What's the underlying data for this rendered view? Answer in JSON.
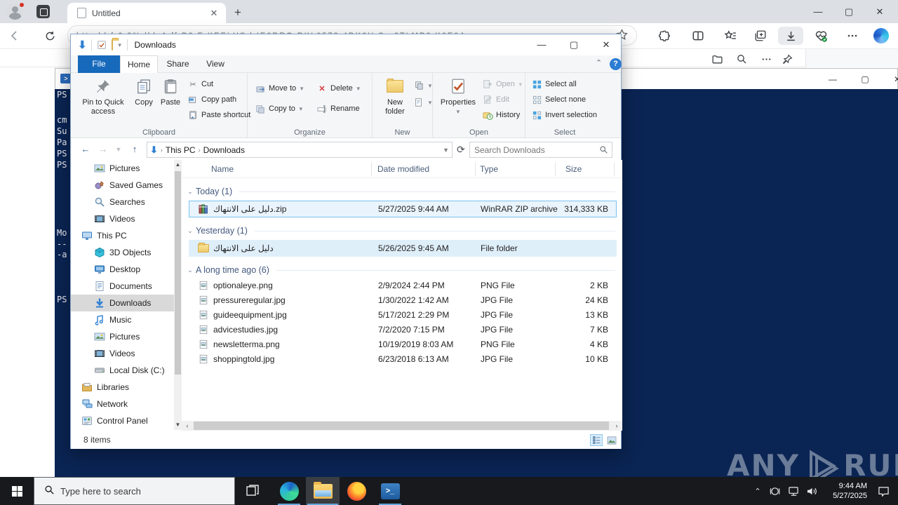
{
  "browser": {
    "tab_title": "Untitled",
    "url_fragment": "http  bl f   6.2%  lkk  A   ff.P6.E  KEELHS.l  IE6RRQ   RKL0573 4DK6U.Se  6TLMP6   K6E0A"
  },
  "powershell": {
    "console_lines": [
      "PS",
      "cm",
      "Su",
      "Pa",
      "PS",
      "PS",
      "Mo",
      "--",
      "-a",
      "PS"
    ]
  },
  "watermark": {
    "any": "ANY",
    "run": "RUN"
  },
  "explorer": {
    "title": "Downloads",
    "tabs": {
      "file": "File",
      "home": "Home",
      "share": "Share",
      "view": "View"
    },
    "ribbon": {
      "pin_to_quick_access": "Pin to Quick access",
      "copy": "Copy",
      "paste": "Paste",
      "cut": "Cut",
      "copy_path": "Copy path",
      "paste_shortcut": "Paste shortcut",
      "move_to": "Move to",
      "copy_to": "Copy to",
      "delete": "Delete",
      "rename": "Rename",
      "new_folder": "New folder",
      "properties": "Properties",
      "open": "Open",
      "edit": "Edit",
      "history": "History",
      "select_all": "Select all",
      "select_none": "Select none",
      "invert_selection": "Invert selection",
      "groups": {
        "clipboard": "Clipboard",
        "organize": "Organize",
        "new": "New",
        "open": "Open",
        "select": "Select"
      }
    },
    "address": {
      "breadcrumb": [
        "This PC",
        "Downloads"
      ],
      "search_placeholder": "Search Downloads"
    },
    "columns": [
      "Name",
      "Date modified",
      "Type",
      "Size"
    ],
    "file_groups": [
      {
        "label": "Today (1)",
        "rows": [
          {
            "name": "دليل على الانتهاك.zip",
            "date": "5/27/2025 9:44 AM",
            "type": "WinRAR ZIP archive",
            "size": "314,333 KB",
            "icon": "winrar",
            "state": "sel"
          }
        ]
      },
      {
        "label": "Yesterday (1)",
        "rows": [
          {
            "name": "دليل على الانتهاك",
            "date": "5/26/2025 9:45 AM",
            "type": "File folder",
            "size": "",
            "icon": "folder",
            "state": "hov"
          }
        ]
      },
      {
        "label": "A long time ago (6)",
        "rows": [
          {
            "name": "optionaleye.png",
            "date": "2/9/2024 2:44 PM",
            "type": "PNG File",
            "size": "2 KB",
            "icon": "image",
            "state": ""
          },
          {
            "name": "pressureregular.jpg",
            "date": "1/30/2022 1:42 AM",
            "type": "JPG File",
            "size": "24 KB",
            "icon": "image",
            "state": ""
          },
          {
            "name": "guideequipment.jpg",
            "date": "5/17/2021 2:29 PM",
            "type": "JPG File",
            "size": "13 KB",
            "icon": "image",
            "state": ""
          },
          {
            "name": "advicestudies.jpg",
            "date": "7/2/2020 7:15 PM",
            "type": "JPG File",
            "size": "7 KB",
            "icon": "image",
            "state": ""
          },
          {
            "name": "newsletterma.png",
            "date": "10/19/2019 8:03 AM",
            "type": "PNG File",
            "size": "4 KB",
            "icon": "image",
            "state": ""
          },
          {
            "name": "shoppingtold.jpg",
            "date": "6/23/2018 6:13 AM",
            "type": "JPG File",
            "size": "10 KB",
            "icon": "image",
            "state": ""
          }
        ]
      }
    ],
    "nav_items": [
      {
        "label": "Pictures",
        "icon": "pictures",
        "indent": 2
      },
      {
        "label": "Saved Games",
        "icon": "saved-games",
        "indent": 2
      },
      {
        "label": "Searches",
        "icon": "searches",
        "indent": 2
      },
      {
        "label": "Videos",
        "icon": "videos",
        "indent": 2
      },
      {
        "label": "This PC",
        "icon": "this-pc",
        "indent": 1
      },
      {
        "label": "3D Objects",
        "icon": "cube",
        "indent": 2
      },
      {
        "label": "Desktop",
        "icon": "desktop",
        "indent": 2
      },
      {
        "label": "Documents",
        "icon": "documents",
        "indent": 2
      },
      {
        "label": "Downloads",
        "icon": "downloads",
        "indent": 2,
        "selected": true
      },
      {
        "label": "Music",
        "icon": "music",
        "indent": 2
      },
      {
        "label": "Pictures",
        "icon": "pictures",
        "indent": 2
      },
      {
        "label": "Videos",
        "icon": "videos",
        "indent": 2
      },
      {
        "label": "Local Disk (C:)",
        "icon": "disk",
        "indent": 2
      },
      {
        "label": "Libraries",
        "icon": "libraries",
        "indent": 1
      },
      {
        "label": "Network",
        "icon": "network",
        "indent": 1
      },
      {
        "label": "Control Panel",
        "icon": "control-panel",
        "indent": 1
      }
    ],
    "status": "8 items"
  },
  "taskbar": {
    "search_placeholder": "Type here to search",
    "clock_time": "9:44 AM",
    "clock_date": "5/27/2025"
  }
}
